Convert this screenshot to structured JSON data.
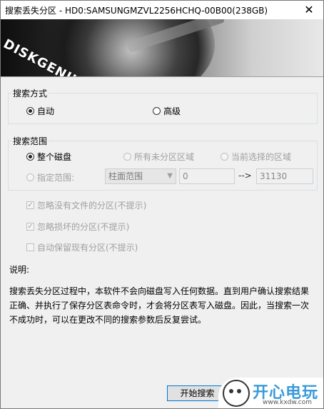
{
  "window": {
    "title": "搜索丢失分区 - HD0:SAMSUNGMZVL2256HCHQ-00B00(238GB)",
    "close_glyph": "✕"
  },
  "banner": {
    "logo_text": "DISKGENIUS"
  },
  "search_mode": {
    "legend": "搜索方式",
    "options": [
      {
        "label": "自动",
        "selected": true
      },
      {
        "label": "高级",
        "selected": false
      }
    ]
  },
  "search_range": {
    "legend": "搜索范围",
    "options": [
      {
        "label": "整个磁盘",
        "selected": true,
        "enabled": true
      },
      {
        "label": "所有未分区区域",
        "selected": false,
        "enabled": false
      },
      {
        "label": "当前选择的区域",
        "selected": false,
        "enabled": false
      },
      {
        "label": "指定范围:",
        "selected": false,
        "enabled": false
      }
    ],
    "unit_select": "柱面范围",
    "from_value": "0",
    "arrow": "-->",
    "to_value": "31130"
  },
  "options": [
    {
      "label": "忽略没有文件的分区(不提示)",
      "checked": true,
      "enabled": false
    },
    {
      "label": "忽略损坏的分区(不提示)",
      "checked": true,
      "enabled": false
    },
    {
      "label": "自动保留现有分区(不提示)",
      "checked": false,
      "enabled": false
    }
  ],
  "notes": {
    "title": "说明:",
    "text": "搜索丢失分区过程中，本软件不会向磁盘写入任何数据。直到用户确认搜索结果正确、并执行了保存分区表命令时，才会将分区表写入磁盘。因此，当搜索一次不成功时，可以在更改不同的搜索参数后反复尝试。"
  },
  "buttons": {
    "start": "开始搜索"
  },
  "watermark": {
    "text": "开心电玩",
    "url": "www.kxdw.com"
  }
}
